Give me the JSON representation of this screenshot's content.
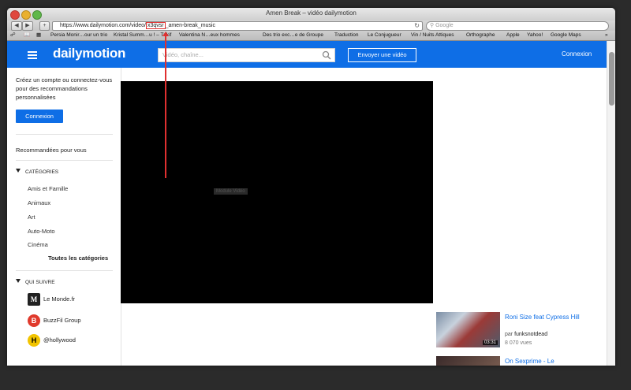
{
  "window": {
    "title": "Amen Break – vidéo dailymotion"
  },
  "toolbar": {
    "url_prefix": "https://www.dailymotion.com/video/",
    "url_highlight": "x3qvsr",
    "url_suffix": "_amen-break_music",
    "search_placeholder": "Google"
  },
  "bookmarks": [
    "Persia Monir…our un trio",
    "Kristal Summ…u ! – Tukif",
    "Valentina N…eux hommes",
    "Des trio exc…e de Groupe",
    "Traduction",
    "Le Conjugueur",
    "Vin / Nuits Attiques",
    "Orthographe",
    "Apple",
    "Yahoo!",
    "Google Maps"
  ],
  "header": {
    "logo": "dailymotion",
    "search_placeholder": "Vidéo, chaîne...",
    "upload_label": "Envoyer une vidéo",
    "login_label": "Connexion"
  },
  "sidebar": {
    "intro": "Créez un compte ou connectez-vous pour des recommandations personnalisées",
    "login_button": "Connexion",
    "recommended": "Recommandées pour vous",
    "categories_title": "CATÉGORIES",
    "categories": [
      "Amis et Famille",
      "Animaux",
      "Art",
      "Auto-Moto",
      "Cinéma"
    ],
    "all_categories": "Toutes les catégories",
    "follow_title": "QUI SUIVRE",
    "follow": [
      {
        "name": "Le Monde.fr",
        "logo": "M"
      },
      {
        "name": "BuzzFil Group",
        "logo": "B"
      },
      {
        "name": "@hollywood",
        "logo": "H"
      }
    ]
  },
  "player": {
    "label": "Module Vidéo"
  },
  "related": [
    {
      "title": "Roni Size feat Cypress Hill",
      "by_prefix": "par ",
      "author": "funksnotdead",
      "views": "8 070 vues",
      "duration": "03:31"
    },
    {
      "title": "On Sexprime - Le"
    }
  ],
  "colors": {
    "brand": "#0e6ee6",
    "annotation": "#e03030"
  }
}
